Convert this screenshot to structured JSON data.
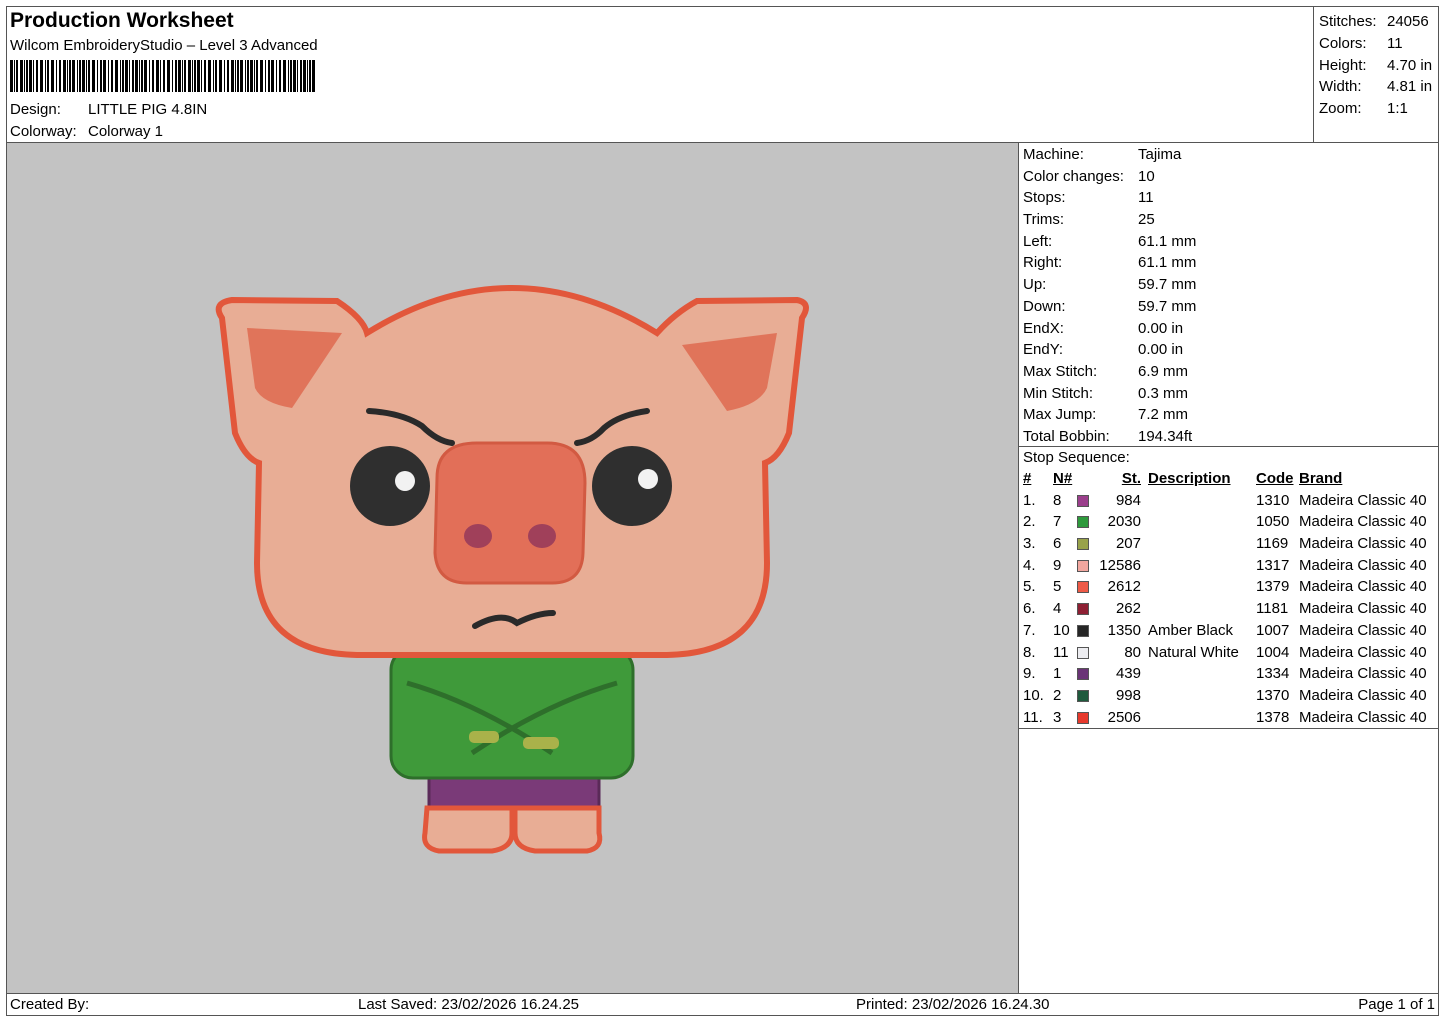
{
  "header": {
    "title": "Production Worksheet",
    "software": "Wilcom EmbroideryStudio – Level 3 Advanced",
    "design_label": "Design:",
    "design_value": "LITTLE PIG 4.8IN",
    "colorway_label": "Colorway:",
    "colorway_value": "Colorway 1"
  },
  "stats": [
    {
      "label": "Stitches:",
      "value": "24056"
    },
    {
      "label": "Colors:",
      "value": "11"
    },
    {
      "label": "Height:",
      "value": "4.70 in"
    },
    {
      "label": "Width:",
      "value": "4.81 in"
    },
    {
      "label": "Zoom:",
      "value": "1:1"
    }
  ],
  "machine_info": [
    {
      "label": "Machine:",
      "value": "Tajima"
    },
    {
      "label": "Color changes:",
      "value": "10"
    },
    {
      "label": "Stops:",
      "value": "11"
    },
    {
      "label": "Trims:",
      "value": "25"
    },
    {
      "label": "Left:",
      "value": "61.1 mm"
    },
    {
      "label": "Right:",
      "value": "61.1 mm"
    },
    {
      "label": "Up:",
      "value": "59.7 mm"
    },
    {
      "label": "Down:",
      "value": "59.7 mm"
    },
    {
      "label": "EndX:",
      "value": "0.00 in"
    },
    {
      "label": "EndY:",
      "value": "0.00 in"
    },
    {
      "label": "Max Stitch:",
      "value": "6.9 mm"
    },
    {
      "label": "Min Stitch:",
      "value": "0.3 mm"
    },
    {
      "label": "Max Jump:",
      "value": "7.2 mm"
    },
    {
      "label": "Total Bobbin:",
      "value": "194.34ft"
    }
  ],
  "stop_sequence": {
    "title": "Stop Sequence:",
    "headers": {
      "idx": "#",
      "n": "N#",
      "st": "St.",
      "desc": "Description",
      "code": "Code",
      "brand": "Brand"
    },
    "rows": [
      {
        "idx": "1.",
        "n": "8",
        "color": "#9b3f8c",
        "st": "984",
        "desc": "",
        "code": "1310",
        "brand": "Madeira Classic 40"
      },
      {
        "idx": "2.",
        "n": "7",
        "color": "#2e9a3c",
        "st": "2030",
        "desc": "",
        "code": "1050",
        "brand": "Madeira Classic 40"
      },
      {
        "idx": "3.",
        "n": "6",
        "color": "#98a24a",
        "st": "207",
        "desc": "",
        "code": "1169",
        "brand": "Madeira Classic 40"
      },
      {
        "idx": "4.",
        "n": "9",
        "color": "#f2a79f",
        "st": "12586",
        "desc": "",
        "code": "1317",
        "brand": "Madeira Classic 40"
      },
      {
        "idx": "5.",
        "n": "5",
        "color": "#ee5a47",
        "st": "2612",
        "desc": "",
        "code": "1379",
        "brand": "Madeira Classic 40"
      },
      {
        "idx": "6.",
        "n": "4",
        "color": "#8e1f33",
        "st": "262",
        "desc": "",
        "code": "1181",
        "brand": "Madeira Classic 40"
      },
      {
        "idx": "7.",
        "n": "10",
        "color": "#262626",
        "st": "1350",
        "desc": "Amber Black",
        "code": "1007",
        "brand": "Madeira Classic 40"
      },
      {
        "idx": "8.",
        "n": "11",
        "color": "#ececf0",
        "st": "80",
        "desc": "Natural White",
        "code": "1004",
        "brand": "Madeira Classic 40"
      },
      {
        "idx": "9.",
        "n": "1",
        "color": "#6a3476",
        "st": "439",
        "desc": "",
        "code": "1334",
        "brand": "Madeira Classic 40"
      },
      {
        "idx": "10.",
        "n": "2",
        "color": "#1f5a3d",
        "st": "998",
        "desc": "",
        "code": "1370",
        "brand": "Madeira Classic 40"
      },
      {
        "idx": "11.",
        "n": "3",
        "color": "#e7392c",
        "st": "2506",
        "desc": "",
        "code": "1378",
        "brand": "Madeira Classic 40"
      }
    ]
  },
  "footer": {
    "created_by": "Created By:",
    "last_saved": "Last Saved: 23/02/2026 16.24.25",
    "printed": "Printed: 23/02/2026 16.24.30",
    "page": "Page 1 of 1"
  },
  "colors": {
    "canvas_bg": "#c3c3c3",
    "outline": "#e2573b",
    "skin": "#e8ad95",
    "jacket": "#3f9a3a",
    "pants": "#7a3a78"
  }
}
